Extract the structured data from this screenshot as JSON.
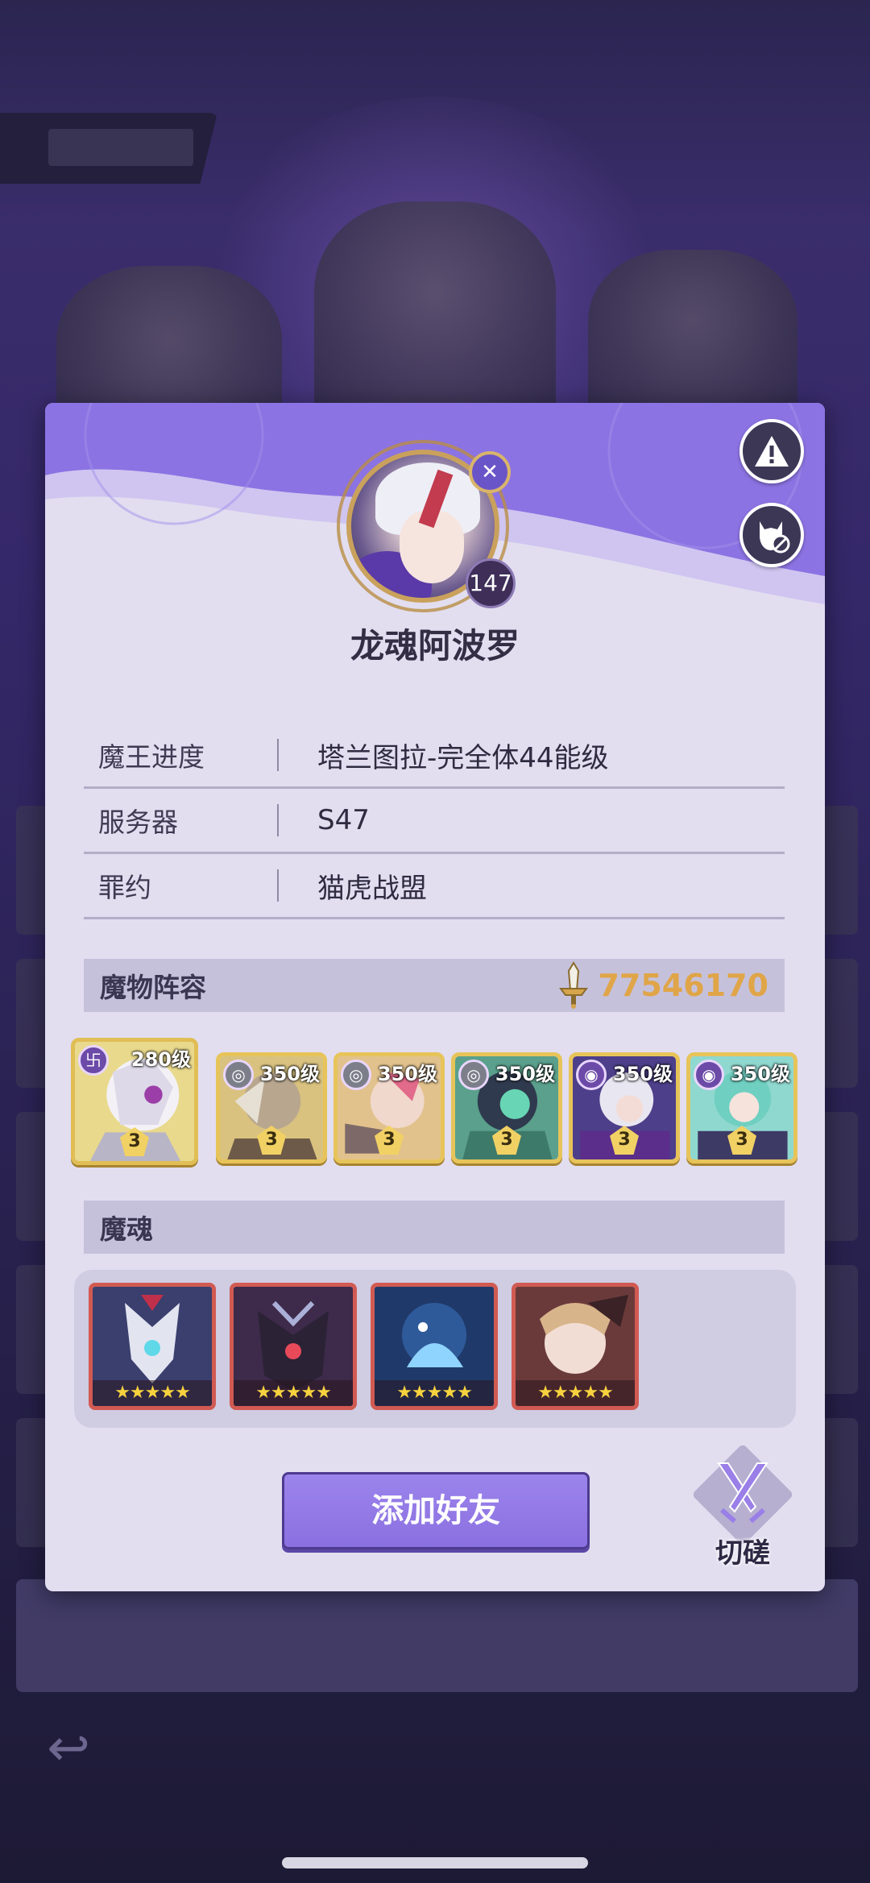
{
  "dialog": {
    "player_name": "龙魂阿波罗",
    "level": "147",
    "info": [
      {
        "label": "魔王进度",
        "value": "塔兰图拉-完全体44能级"
      },
      {
        "label": "服务器",
        "value": "S47"
      },
      {
        "label": "罪约",
        "value": "猫虎战盟"
      }
    ],
    "lineup": {
      "title": "魔物阵容",
      "power": "77546170",
      "monsters": [
        {
          "level": "280级",
          "stars": "3",
          "element": "wind"
        },
        {
          "level": "350级",
          "stars": "3",
          "element": "neutral"
        },
        {
          "level": "350级",
          "stars": "3",
          "element": "neutral"
        },
        {
          "level": "350级",
          "stars": "3",
          "element": "neutral"
        },
        {
          "level": "350级",
          "stars": "3",
          "element": "dark"
        },
        {
          "level": "350级",
          "stars": "3",
          "element": "dark"
        }
      ]
    },
    "souls": {
      "title": "魔魂",
      "items": [
        {
          "stars": "★★★★★"
        },
        {
          "stars": "★★★★★"
        },
        {
          "stars": "★★★★★"
        },
        {
          "stars": "★★★★★"
        }
      ]
    },
    "add_friend_label": "添加好友",
    "duel_label": "切磋"
  },
  "colors": {
    "accent": "#8a70e0",
    "power": "#e0a548",
    "frame_gold": "#e7c45a",
    "soul_frame": "#d15a52",
    "header_purple": "#8c73e3"
  }
}
